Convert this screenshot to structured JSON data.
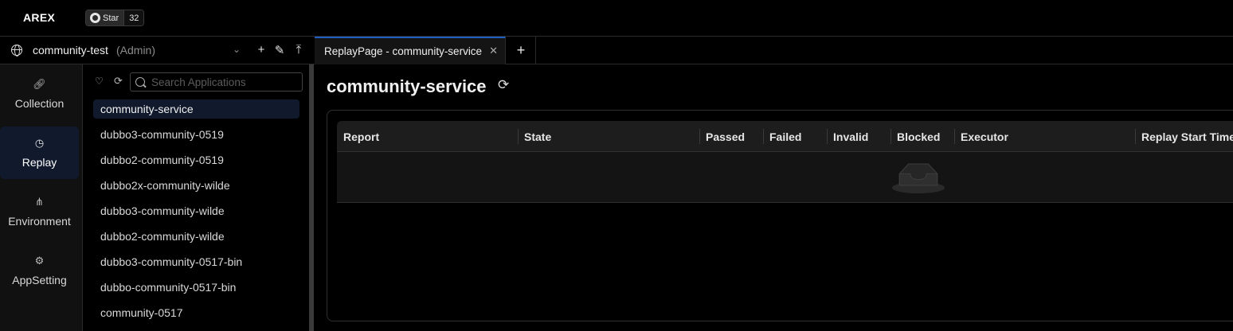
{
  "app": {
    "brand": "AREX",
    "github": {
      "label": "Star",
      "count": "32"
    }
  },
  "workspace": {
    "name": "community-test",
    "role": "(Admin)",
    "icons": [
      "globe-icon",
      "chevron-down-icon",
      "plus-icon",
      "edit-icon",
      "upload-icon"
    ]
  },
  "tabs": {
    "items": [
      {
        "label": "ReplayPage - community-service",
        "active": true
      }
    ],
    "accent": "#1f5fbf"
  },
  "nav": {
    "items": [
      {
        "label": "Collection",
        "icon": "link-icon",
        "active": false
      },
      {
        "label": "Replay",
        "icon": "clock-icon",
        "active": true
      },
      {
        "label": "Environment",
        "icon": "network-icon",
        "active": false
      },
      {
        "label": "AppSetting",
        "icon": "gear-icon",
        "active": false
      }
    ]
  },
  "apps": {
    "search_placeholder": "Search Applications",
    "items": [
      "community-service",
      "dubbo3-community-0519",
      "dubbo2-community-0519",
      "dubbo2x-community-wilde",
      "dubbo3-community-wilde",
      "dubbo2-community-wilde",
      "dubbo3-community-0517-bin",
      "dubbo-community-0517-bin",
      "community-0517"
    ],
    "selected": "community-service"
  },
  "main": {
    "title": "community-service",
    "table": {
      "columns": [
        "Report",
        "State",
        "Passed",
        "Failed",
        "Invalid",
        "Blocked",
        "Executor",
        "Replay Start Time"
      ],
      "rows": []
    }
  },
  "colors": {
    "background": "#000000",
    "active_nav_bg": "#111a2c",
    "tab_accent": "#1f5fbf"
  }
}
